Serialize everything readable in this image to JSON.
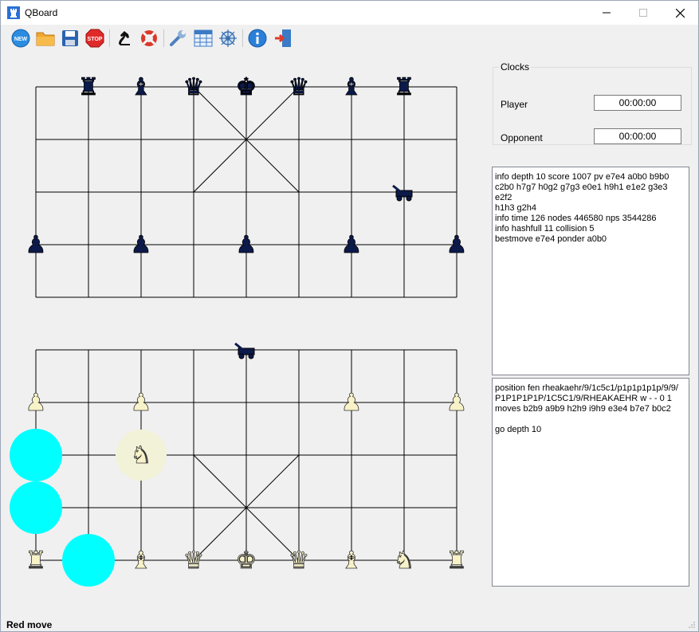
{
  "window": {
    "title": "QBoard"
  },
  "toolbar": {
    "buttons": [
      {
        "name": "new-icon",
        "label": "NEW"
      },
      {
        "name": "open-folder-icon"
      },
      {
        "name": "save-icon"
      },
      {
        "name": "stop-icon",
        "label": "STOP"
      },
      {
        "name": "knight-engine-icon"
      },
      {
        "name": "lifebuoy-icon"
      },
      {
        "name": "wrench-icon"
      },
      {
        "name": "table-icon"
      },
      {
        "name": "network-icon"
      },
      {
        "name": "info-icon"
      },
      {
        "name": "exit-icon"
      }
    ]
  },
  "clocks": {
    "title": "Clocks",
    "player_label": "Player",
    "player_time": "00:00:00",
    "opponent_label": "Opponent",
    "opponent_time": "00:00:00"
  },
  "engine_output": "info depth 10 score 1007 pv e7e4 a0b0 b9b0\nc2b0 h7g7 h0g2 g7g3 e0e1 h9h1 e1e2 g3e3 e2f2\nh1h3 g2h4\ninfo time 126 nodes 446580 nps 3544286\ninfo hashfull 11 collision 5\nbestmove e7e4 ponder a0b0",
  "engine_input": "position fen rheakaehr/9/1c5c1/p1p1p1p1p/9/9/\nP1P1P1P1P/1C5C1/9/RHEAKAEHR w - - 0 1\nmoves b2b9 a9b9 h2h9 i9h9 e3e4 b7e7 b0c2\n\ngo depth 10",
  "status": "Red move",
  "colors": {
    "dark_piece": "#0c1a4a",
    "light_piece": "#f7f2c8",
    "highlight": "#00ffff",
    "selected": "#f2f2d8"
  },
  "pieces": [
    {
      "side": "black",
      "type": "rook",
      "file": 1,
      "rank": 9
    },
    {
      "side": "black",
      "type": "elephant",
      "file": 2,
      "rank": 9
    },
    {
      "side": "black",
      "type": "advisor",
      "file": 3,
      "rank": 9
    },
    {
      "side": "black",
      "type": "king",
      "file": 4,
      "rank": 9
    },
    {
      "side": "black",
      "type": "advisor",
      "file": 5,
      "rank": 9
    },
    {
      "side": "black",
      "type": "elephant",
      "file": 6,
      "rank": 9
    },
    {
      "side": "black",
      "type": "rook",
      "file": 7,
      "rank": 9
    },
    {
      "side": "black",
      "type": "cannon",
      "file": 7,
      "rank": 7
    },
    {
      "side": "black",
      "type": "pawn",
      "file": 0,
      "rank": 6
    },
    {
      "side": "black",
      "type": "pawn",
      "file": 2,
      "rank": 6
    },
    {
      "side": "black",
      "type": "pawn",
      "file": 4,
      "rank": 6
    },
    {
      "side": "black",
      "type": "pawn",
      "file": 6,
      "rank": 6
    },
    {
      "side": "black",
      "type": "pawn",
      "file": 8,
      "rank": 6
    },
    {
      "side": "black",
      "type": "cannon",
      "file": 4,
      "rank": 4
    },
    {
      "side": "red",
      "type": "pawn",
      "file": 0,
      "rank": 3
    },
    {
      "side": "red",
      "type": "pawn",
      "file": 2,
      "rank": 3
    },
    {
      "side": "red",
      "type": "pawn",
      "file": 6,
      "rank": 3
    },
    {
      "side": "red",
      "type": "pawn",
      "file": 8,
      "rank": 3
    },
    {
      "side": "red",
      "type": "horse",
      "file": 2,
      "rank": 2,
      "selected": true
    },
    {
      "side": "red",
      "type": "rook",
      "file": 0,
      "rank": 0
    },
    {
      "side": "red",
      "type": "elephant",
      "file": 2,
      "rank": 0
    },
    {
      "side": "red",
      "type": "advisor",
      "file": 3,
      "rank": 0
    },
    {
      "side": "red",
      "type": "king",
      "file": 4,
      "rank": 0
    },
    {
      "side": "red",
      "type": "advisor",
      "file": 5,
      "rank": 0
    },
    {
      "side": "red",
      "type": "elephant",
      "file": 6,
      "rank": 0
    },
    {
      "side": "red",
      "type": "horse",
      "file": 7,
      "rank": 0
    },
    {
      "side": "red",
      "type": "rook",
      "file": 8,
      "rank": 0
    }
  ],
  "move_targets": [
    {
      "file": 0,
      "rank": 2
    },
    {
      "file": 0,
      "rank": 1
    },
    {
      "file": 1,
      "rank": 0
    }
  ]
}
